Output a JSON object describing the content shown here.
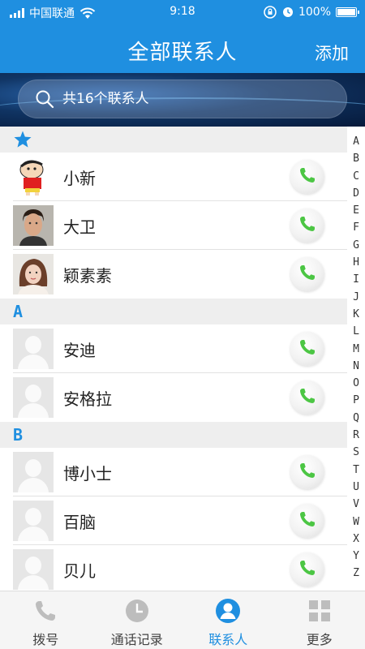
{
  "status_bar": {
    "carrier": "中国联通",
    "time": "9:18",
    "battery": "100%",
    "battery_level": 1.0
  },
  "nav": {
    "title": "全部联系人",
    "add_label": "添加"
  },
  "search": {
    "placeholder": "共16个联系人"
  },
  "sections": [
    {
      "header": "★",
      "contacts": [
        {
          "name": "小新",
          "avatar": "cartoon-boy"
        },
        {
          "name": "大卫",
          "avatar": "man-photo"
        },
        {
          "name": "颖素素",
          "avatar": "woman-photo"
        }
      ]
    },
    {
      "header": "A",
      "contacts": [
        {
          "name": "安迪",
          "avatar": "default"
        },
        {
          "name": "安格拉",
          "avatar": "default"
        }
      ]
    },
    {
      "header": "B",
      "contacts": [
        {
          "name": "博小士",
          "avatar": "default"
        },
        {
          "name": "百脑",
          "avatar": "default"
        },
        {
          "name": "贝儿",
          "avatar": "default"
        }
      ]
    }
  ],
  "alphabet": [
    "A",
    "B",
    "C",
    "D",
    "E",
    "F",
    "G",
    "H",
    "I",
    "J",
    "K",
    "L",
    "M",
    "N",
    "O",
    "P",
    "Q",
    "R",
    "S",
    "T",
    "U",
    "V",
    "W",
    "X",
    "Y",
    "Z"
  ],
  "tabs": [
    {
      "label": "拨号",
      "icon": "phone-icon",
      "active": false
    },
    {
      "label": "通话记录",
      "icon": "clock-icon",
      "active": false
    },
    {
      "label": "联系人",
      "icon": "contact-icon",
      "active": true
    },
    {
      "label": "更多",
      "icon": "grid-icon",
      "active": false
    }
  ],
  "colors": {
    "primary": "#1f8fe0",
    "call_green": "#4cc644",
    "tab_inactive_icon": "#bdbdbd"
  }
}
